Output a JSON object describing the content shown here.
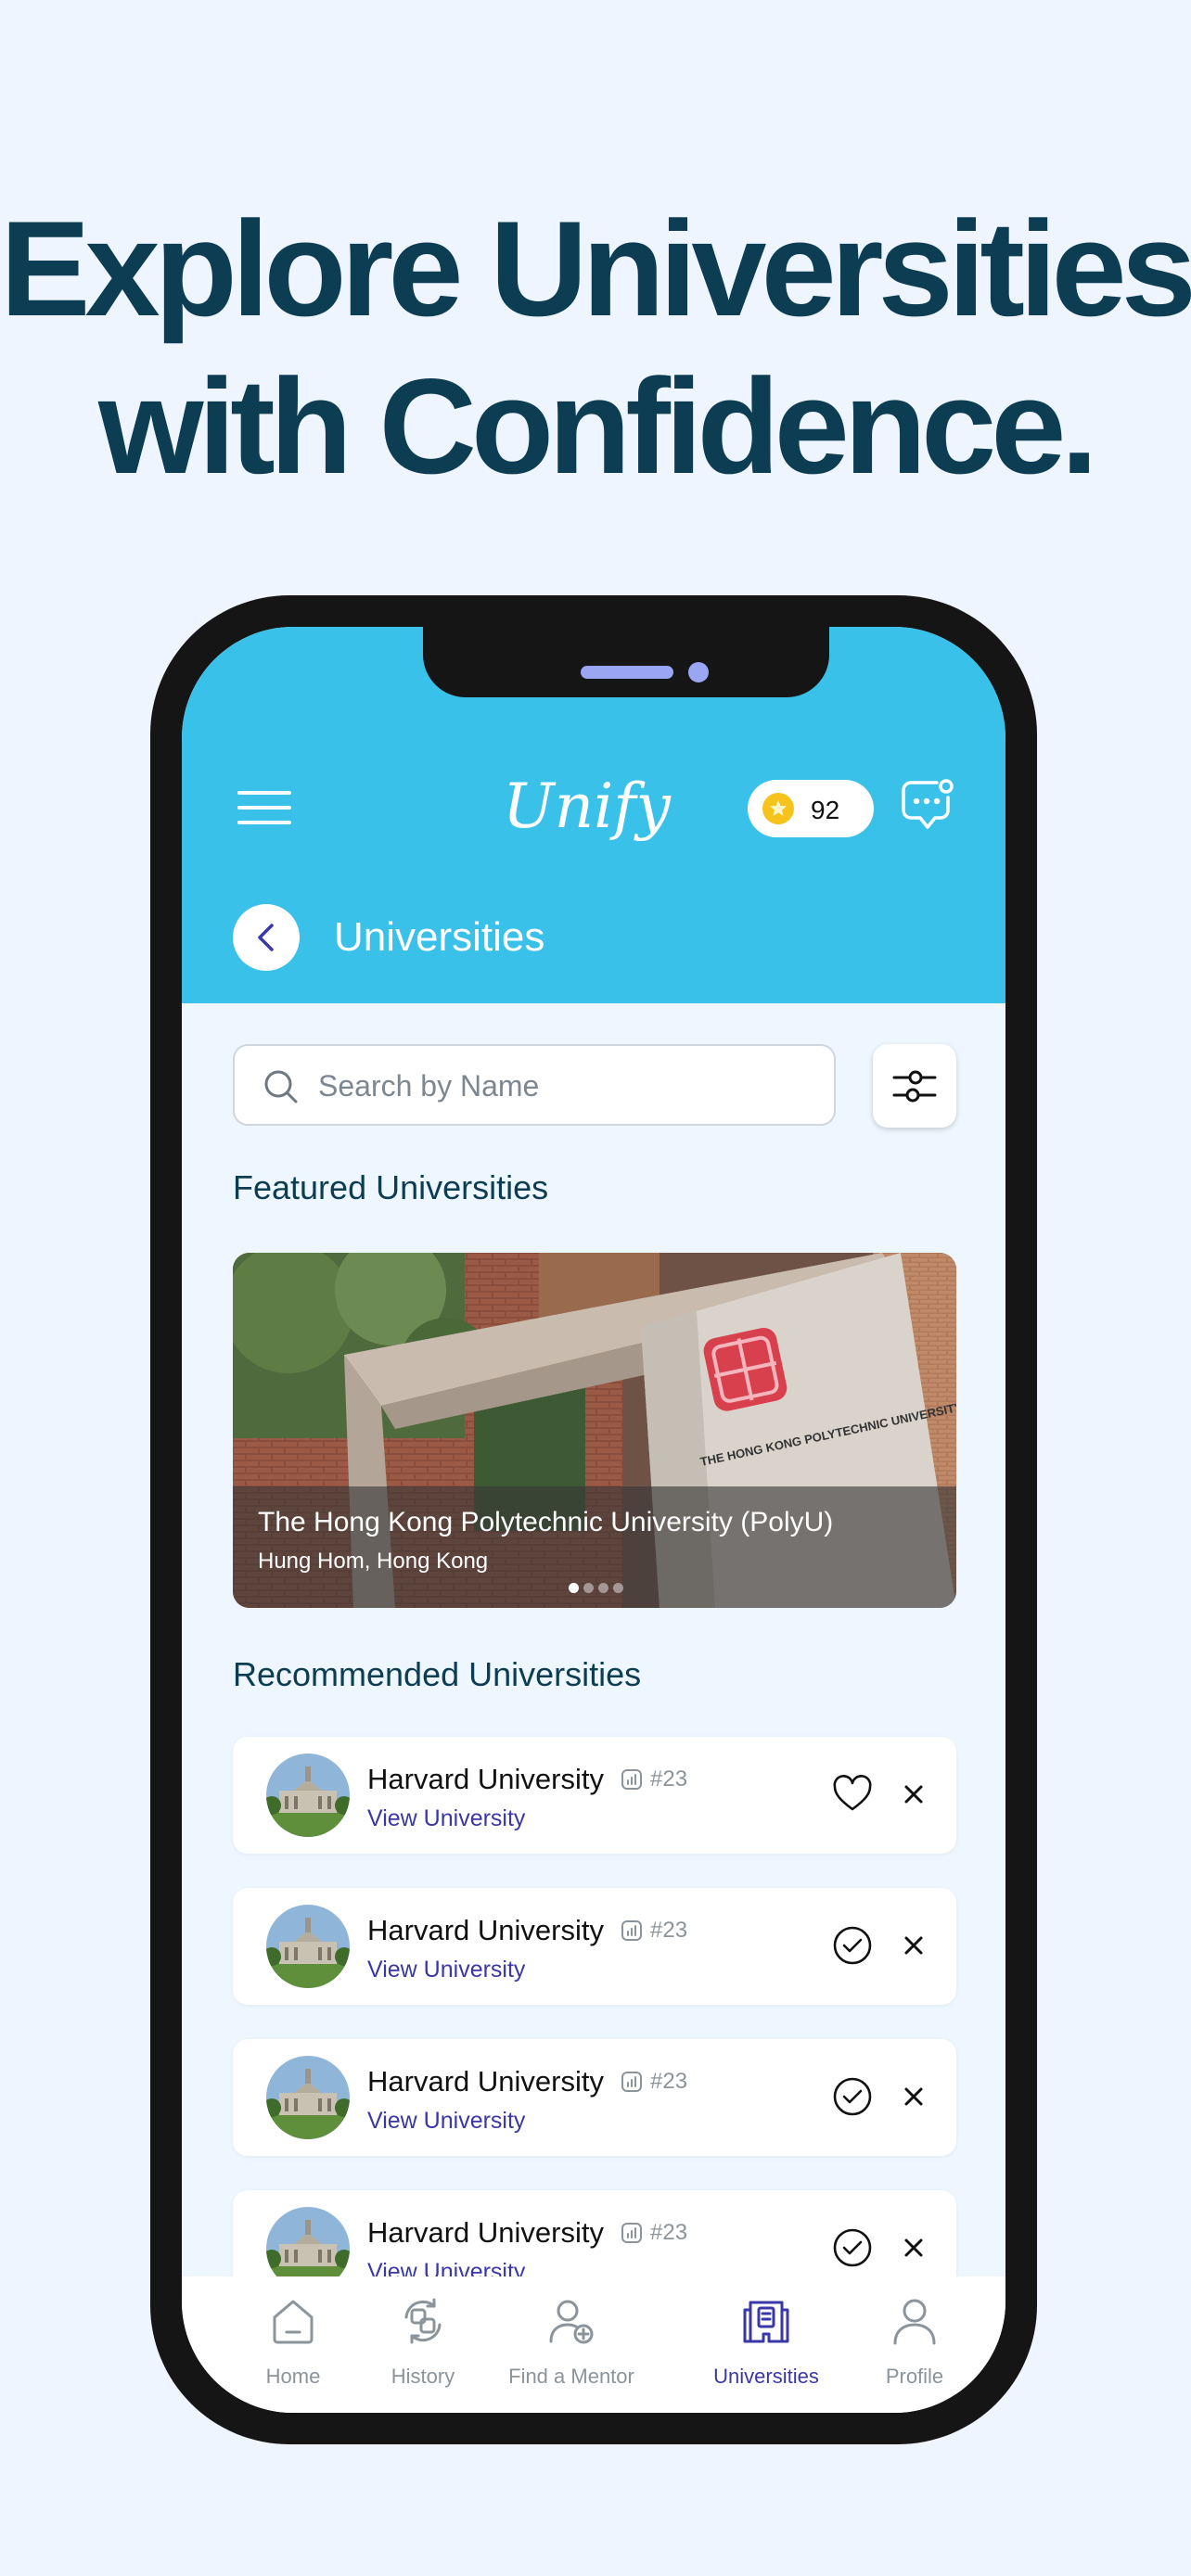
{
  "headline": {
    "line1": "Explore Universities",
    "line2": "with Confidence."
  },
  "header": {
    "logo": "Unify",
    "coins": "92"
  },
  "page": {
    "title": "Universities"
  },
  "search": {
    "placeholder": "Search by Name"
  },
  "featured": {
    "section_title": "Featured Universities",
    "name": "The Hong Kong Polytechnic University (PolyU)",
    "location": "Hung Hom, Hong Kong",
    "sign_text": "THE HONG KONG POLYTECHNIC UNIVERSITY",
    "slide_index": 1,
    "slide_count": 4
  },
  "recommended": {
    "section_title": "Recommended Universities",
    "items": [
      {
        "name": "Harvard University",
        "rank": "#23",
        "link": "View University",
        "action_icon": "heart-icon"
      },
      {
        "name": "Harvard University",
        "rank": "#23",
        "link": "View University",
        "action_icon": "check-circle-icon"
      },
      {
        "name": "Harvard University",
        "rank": "#23",
        "link": "View University",
        "action_icon": "check-circle-icon"
      },
      {
        "name": "Harvard University",
        "rank": "#23",
        "link": "View University",
        "action_icon": "check-circle-icon"
      }
    ]
  },
  "tabbar": {
    "active": "Universities",
    "tabs": [
      {
        "label": "Home",
        "icon": "home-icon"
      },
      {
        "label": "History",
        "icon": "history-icon"
      },
      {
        "label": "Find a Mentor",
        "icon": "mentor-icon"
      },
      {
        "label": "Universities",
        "icon": "universities-icon"
      },
      {
        "label": "Profile",
        "icon": "profile-icon"
      }
    ]
  },
  "colors": {
    "background": "#eff5fe",
    "headline": "#0d3d52",
    "header": "#3ac1e9",
    "accent": "#3a37a8",
    "coin": "#f6c21c"
  }
}
